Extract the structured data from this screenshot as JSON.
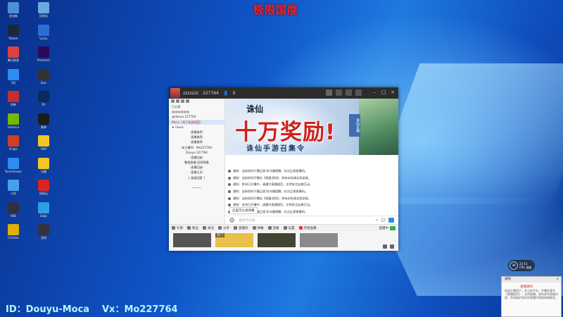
{
  "stream": {
    "title": "极限国度",
    "id_text": "ID：Douyu-Moca",
    "vx_text": "Vx：Mo227764"
  },
  "desktop_icons": [
    {
      "label": "此电脑",
      "color": "#4d8fd6"
    },
    {
      "label": "回收站",
      "color": "#6aa8e0"
    },
    {
      "label": "Steam",
      "color": "#1b2838"
    },
    {
      "label": "Uplay",
      "color": "#2a6fd6"
    },
    {
      "label": "腾讯视频",
      "color": "#e04040"
    },
    {
      "label": "Premiere",
      "color": "#2b0a58"
    },
    {
      "label": "QQ",
      "color": "#2d8cf0"
    },
    {
      "label": "Epic",
      "color": "#333333"
    },
    {
      "label": "剪映",
      "color": "#c43030"
    },
    {
      "label": "PS",
      "color": "#0b2b5a"
    },
    {
      "label": "GeForce",
      "color": "#76b900"
    },
    {
      "label": "雷神",
      "color": "#1c1c1c"
    },
    {
      "label": "Origin",
      "color": "#d04020"
    },
    {
      "label": "IDM",
      "color": "#f3c623"
    },
    {
      "label": "TeamViewer",
      "color": "#2d8cf0"
    },
    {
      "label": "迅雷",
      "color": "#f3c623"
    },
    {
      "label": "斗鱼",
      "color": "#4aa0e8"
    },
    {
      "label": "网易云",
      "color": "#d22"
    },
    {
      "label": "OBS",
      "color": "#303040"
    },
    {
      "label": "Edge",
      "color": "#2da0e0"
    },
    {
      "label": "Chrome",
      "color": "#e0b000"
    },
    {
      "label": "游戏",
      "color": "#334"
    }
  ],
  "window": {
    "room_name": "zzzzzzz",
    "room_id": "227764",
    "viewers": "0",
    "room_tag": "直播间"
  },
  "sidebar": {
    "lines": [
      "已分享",
      "@@@@@@",
      "@douyu 227764",
      "Moca（关于极限国度）",
      "  ★ moca",
      "  ·直播推荐·",
      "  ·直播推荐·",
      "  ·直播推荐·",
      "  本主播ID：Mo227764",
      "  Douyu 227764",
      "  ·直播回放·",
      "  整理直播 回顾锦集",
      "  ·直播回放·",
      "  ·直播主页·",
      "  [ 极限国度 ]",
      "",
      "  ─────"
    ]
  },
  "banner": {
    "logo": "诛仙",
    "headline": "十万奖励!",
    "subline": "诛仙手游召集令",
    "badge": "诛仙主播"
  },
  "chat": {
    "messages": [
      "通知：当前房间只播正规 防诈骗提醒，在对正规直播间。",
      "通知：当前房间开播告【观看须知】，如有纠纷请全程录屏。",
      "通知：房间已开播中，请遵守直播规范，文明发言友善互动。",
      "通知：当前房间只播正规 防诈骗提醒，在对正规直播间。",
      "通知：当前房间开播告【观看须知】，如有纠纷请全程录屏。",
      "通知：房间已开播中，请遵守直播规范，文明发言友善互动。",
      "通知：当前房间只播正规 防诈骗提醒，在对正规直播间。"
    ],
    "tooltip": "这里可以发弹幕"
  },
  "input": {
    "placeholder": "说点什么吧..."
  },
  "toolbar": {
    "items": [
      "礼物",
      "粉丝",
      "关注",
      "分享",
      "直播间",
      "弹幕",
      "直播",
      "设置"
    ],
    "live_label": "开始直播",
    "right_label": "直播中"
  },
  "thumbs": [
    {
      "caption": "",
      "color": "#555"
    },
    {
      "caption": "热门",
      "color": "#e8c04a"
    },
    {
      "caption": "",
      "color": "#443"
    },
    {
      "caption": "",
      "color": "#8a8a8a"
    }
  ],
  "clock": {
    "value": "36",
    "line1": "23:15",
    "line2": "CPU 温度"
  },
  "notification": {
    "header": "通知",
    "title": "直播通知",
    "body": "欢迎主播用户，本斗鱼平台，开播应遵守《直播规范》，文明直播，请勿发布违规内容，共同维护良好的直播环境和网络秩序。"
  }
}
